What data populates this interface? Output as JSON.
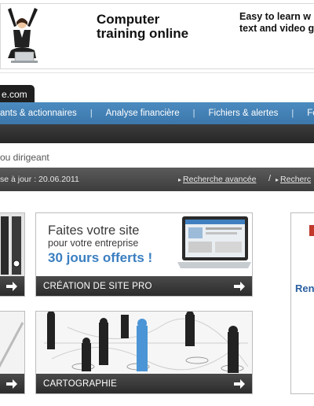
{
  "banner": {
    "title": "Computer\ntraining online",
    "tagline": "Easy to learn w\ntext and video g"
  },
  "site_tab": {
    "label": "e.com"
  },
  "nav": {
    "items": [
      {
        "label": "ants & actionnaires"
      },
      {
        "label": "Analyse financière"
      },
      {
        "label": "Fichiers & alertes"
      },
      {
        "label": "For"
      }
    ],
    "separator": "|"
  },
  "breadcrumb": {
    "text": "ou dirigeant"
  },
  "update_bar": {
    "text": "se à jour : 20.06.2011",
    "advanced_search": "Recherche avancée",
    "slash": "/",
    "search2": "Recherc"
  },
  "tiles": [
    {
      "headline": "Faites votre site",
      "sub": "pour votre entreprise",
      "offer": "30 jours offerts !",
      "label": "CRÉATION DE SITE PRO"
    },
    {
      "label": "CARTOGRAPHIE"
    }
  ],
  "right_box": {
    "text": "Ren"
  },
  "colors": {
    "nav_blue": "#4180b6",
    "dark_strip": "#2f2f2f",
    "offer_blue": "#3a7ec1",
    "right_red": "#c0392b"
  },
  "icons": [
    "arrow-right-icon",
    "triangle-bullet-icon"
  ]
}
